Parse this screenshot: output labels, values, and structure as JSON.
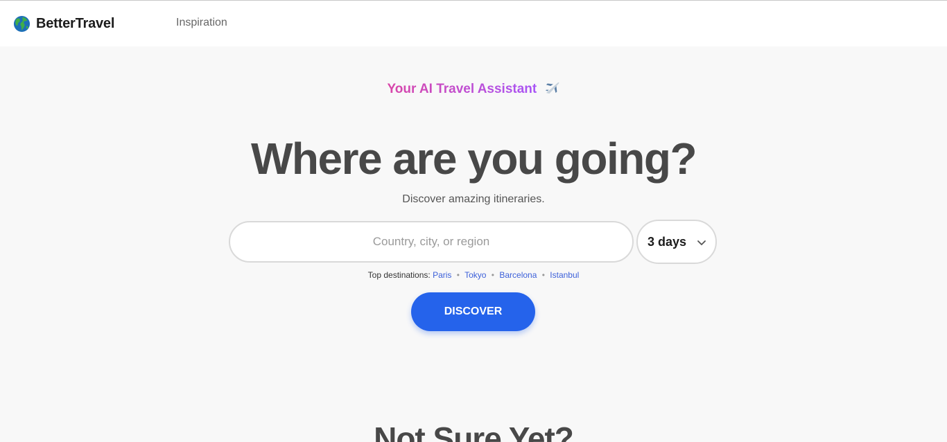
{
  "nav": {
    "brand": "BetterTravel",
    "brand_icon": "globe-icon",
    "links": [
      "Inspiration"
    ]
  },
  "hero": {
    "tagline": "Your AI Travel Assistant",
    "tagline_icon": "airplane-icon",
    "title": "Where are you going?",
    "subtitle": "Discover amazing itineraries."
  },
  "search": {
    "value": "",
    "placeholder": "Country, city, or region",
    "days_selected": "3 days"
  },
  "top_destinations": {
    "label": "Top destinations:",
    "items": [
      "Paris",
      "Tokyo",
      "Barcelona",
      "Istanbul"
    ],
    "separator": "•"
  },
  "cta": {
    "label": "DISCOVER"
  },
  "next_section": {
    "title": "Not Sure Yet?"
  },
  "colors": {
    "accent": "#2563eb",
    "tagline_start": "#d946a8",
    "tagline_end": "#a855f7",
    "link": "#3b5fd9"
  }
}
